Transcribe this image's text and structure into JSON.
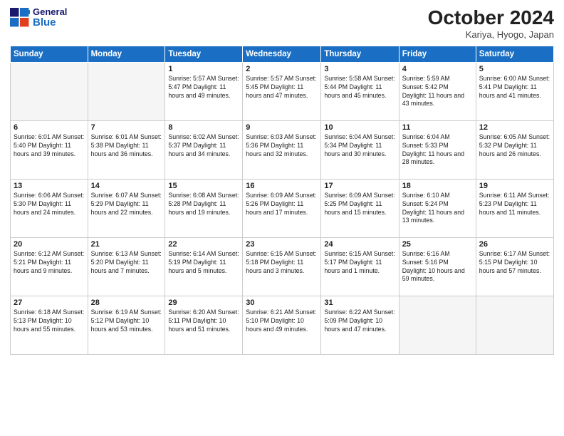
{
  "header": {
    "logo_general": "General",
    "logo_blue": "Blue",
    "month_title": "October 2024",
    "location": "Kariya, Hyogo, Japan"
  },
  "weekdays": [
    "Sunday",
    "Monday",
    "Tuesday",
    "Wednesday",
    "Thursday",
    "Friday",
    "Saturday"
  ],
  "weeks": [
    [
      {
        "day": "",
        "detail": ""
      },
      {
        "day": "",
        "detail": ""
      },
      {
        "day": "1",
        "detail": "Sunrise: 5:57 AM\nSunset: 5:47 PM\nDaylight: 11 hours and 49 minutes."
      },
      {
        "day": "2",
        "detail": "Sunrise: 5:57 AM\nSunset: 5:45 PM\nDaylight: 11 hours and 47 minutes."
      },
      {
        "day": "3",
        "detail": "Sunrise: 5:58 AM\nSunset: 5:44 PM\nDaylight: 11 hours and 45 minutes."
      },
      {
        "day": "4",
        "detail": "Sunrise: 5:59 AM\nSunset: 5:42 PM\nDaylight: 11 hours and 43 minutes."
      },
      {
        "day": "5",
        "detail": "Sunrise: 6:00 AM\nSunset: 5:41 PM\nDaylight: 11 hours and 41 minutes."
      }
    ],
    [
      {
        "day": "6",
        "detail": "Sunrise: 6:01 AM\nSunset: 5:40 PM\nDaylight: 11 hours and 39 minutes."
      },
      {
        "day": "7",
        "detail": "Sunrise: 6:01 AM\nSunset: 5:38 PM\nDaylight: 11 hours and 36 minutes."
      },
      {
        "day": "8",
        "detail": "Sunrise: 6:02 AM\nSunset: 5:37 PM\nDaylight: 11 hours and 34 minutes."
      },
      {
        "day": "9",
        "detail": "Sunrise: 6:03 AM\nSunset: 5:36 PM\nDaylight: 11 hours and 32 minutes."
      },
      {
        "day": "10",
        "detail": "Sunrise: 6:04 AM\nSunset: 5:34 PM\nDaylight: 11 hours and 30 minutes."
      },
      {
        "day": "11",
        "detail": "Sunrise: 6:04 AM\nSunset: 5:33 PM\nDaylight: 11 hours and 28 minutes."
      },
      {
        "day": "12",
        "detail": "Sunrise: 6:05 AM\nSunset: 5:32 PM\nDaylight: 11 hours and 26 minutes."
      }
    ],
    [
      {
        "day": "13",
        "detail": "Sunrise: 6:06 AM\nSunset: 5:30 PM\nDaylight: 11 hours and 24 minutes."
      },
      {
        "day": "14",
        "detail": "Sunrise: 6:07 AM\nSunset: 5:29 PM\nDaylight: 11 hours and 22 minutes."
      },
      {
        "day": "15",
        "detail": "Sunrise: 6:08 AM\nSunset: 5:28 PM\nDaylight: 11 hours and 19 minutes."
      },
      {
        "day": "16",
        "detail": "Sunrise: 6:09 AM\nSunset: 5:26 PM\nDaylight: 11 hours and 17 minutes."
      },
      {
        "day": "17",
        "detail": "Sunrise: 6:09 AM\nSunset: 5:25 PM\nDaylight: 11 hours and 15 minutes."
      },
      {
        "day": "18",
        "detail": "Sunrise: 6:10 AM\nSunset: 5:24 PM\nDaylight: 11 hours and 13 minutes."
      },
      {
        "day": "19",
        "detail": "Sunrise: 6:11 AM\nSunset: 5:23 PM\nDaylight: 11 hours and 11 minutes."
      }
    ],
    [
      {
        "day": "20",
        "detail": "Sunrise: 6:12 AM\nSunset: 5:21 PM\nDaylight: 11 hours and 9 minutes."
      },
      {
        "day": "21",
        "detail": "Sunrise: 6:13 AM\nSunset: 5:20 PM\nDaylight: 11 hours and 7 minutes."
      },
      {
        "day": "22",
        "detail": "Sunrise: 6:14 AM\nSunset: 5:19 PM\nDaylight: 11 hours and 5 minutes."
      },
      {
        "day": "23",
        "detail": "Sunrise: 6:15 AM\nSunset: 5:18 PM\nDaylight: 11 hours and 3 minutes."
      },
      {
        "day": "24",
        "detail": "Sunrise: 6:15 AM\nSunset: 5:17 PM\nDaylight: 11 hours and 1 minute."
      },
      {
        "day": "25",
        "detail": "Sunrise: 6:16 AM\nSunset: 5:16 PM\nDaylight: 10 hours and 59 minutes."
      },
      {
        "day": "26",
        "detail": "Sunrise: 6:17 AM\nSunset: 5:15 PM\nDaylight: 10 hours and 57 minutes."
      }
    ],
    [
      {
        "day": "27",
        "detail": "Sunrise: 6:18 AM\nSunset: 5:13 PM\nDaylight: 10 hours and 55 minutes."
      },
      {
        "day": "28",
        "detail": "Sunrise: 6:19 AM\nSunset: 5:12 PM\nDaylight: 10 hours and 53 minutes."
      },
      {
        "day": "29",
        "detail": "Sunrise: 6:20 AM\nSunset: 5:11 PM\nDaylight: 10 hours and 51 minutes."
      },
      {
        "day": "30",
        "detail": "Sunrise: 6:21 AM\nSunset: 5:10 PM\nDaylight: 10 hours and 49 minutes."
      },
      {
        "day": "31",
        "detail": "Sunrise: 6:22 AM\nSunset: 5:09 PM\nDaylight: 10 hours and 47 minutes."
      },
      {
        "day": "",
        "detail": ""
      },
      {
        "day": "",
        "detail": ""
      }
    ]
  ]
}
